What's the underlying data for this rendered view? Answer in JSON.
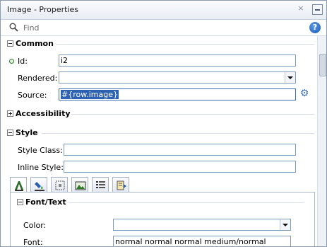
{
  "window": {
    "title": "Image - Properties",
    "close_glyph": "×"
  },
  "search": {
    "placeholder": "Find",
    "value": "",
    "help_glyph": "?"
  },
  "sections": {
    "common": {
      "title": "Common",
      "fields": {
        "id": {
          "label": "Id:",
          "value": "i2"
        },
        "rendered": {
          "label": "Rendered:",
          "value": ""
        },
        "source": {
          "label": "Source:",
          "value": "#{row.image}"
        }
      }
    },
    "accessibility": {
      "title": "Accessibility"
    },
    "style": {
      "title": "Style",
      "fields": {
        "style_class": {
          "label": "Style Class:",
          "value": ""
        },
        "inline_style": {
          "label": "Inline Style:",
          "value": ""
        }
      },
      "tabs": [
        {
          "icon": "font-text-tab-icon"
        },
        {
          "icon": "background-tab-icon"
        },
        {
          "icon": "box-tab-icon"
        },
        {
          "icon": "image-tab-icon"
        },
        {
          "icon": "list-tab-icon"
        },
        {
          "icon": "misc-tab-icon"
        }
      ],
      "font_text": {
        "title": "Font/Text",
        "fields": {
          "color": {
            "label": "Color:",
            "value": ""
          },
          "font": {
            "label": "Font:",
            "value": "normal normal normal medium/normal"
          }
        }
      }
    }
  },
  "colors": {
    "accent": "#2b62b3",
    "frame": "#8c9bb0"
  }
}
